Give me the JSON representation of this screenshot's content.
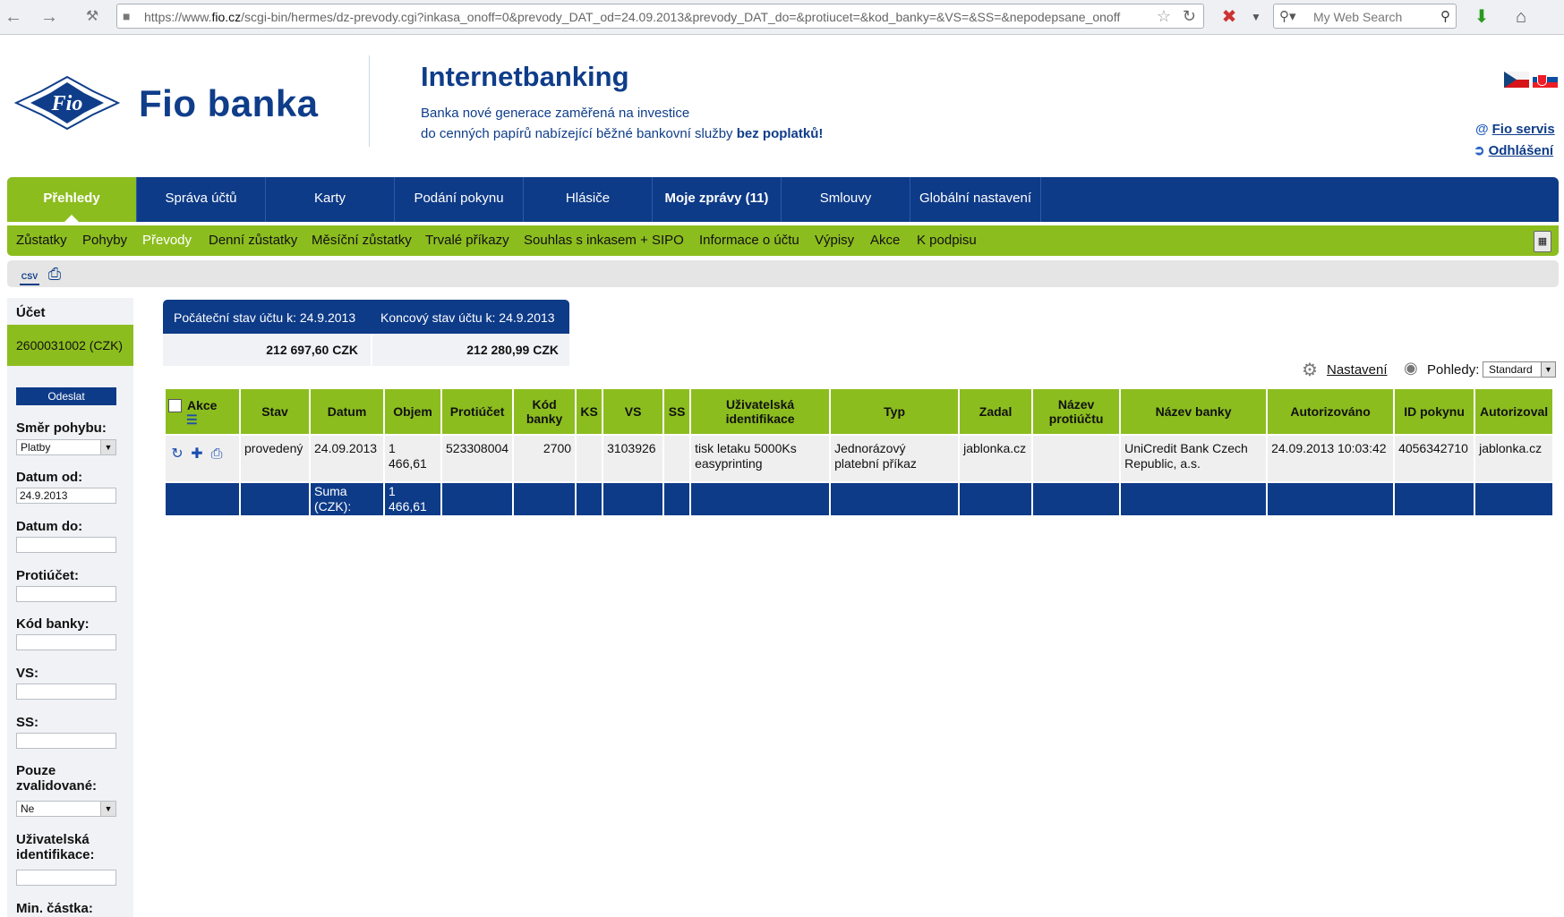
{
  "browser": {
    "url_prefix": "https://www.",
    "url_domain": "fio.cz",
    "url_rest": "/scgi-bin/hermes/dz-prevody.cgi?inkasa_onoff=0&prevody_DAT_od=24.09.2013&prevody_DAT_do=&protiucet=&kod_banky=&VS=&SS=&nepodepsane_onoff",
    "search_placeholder": "My Web Search"
  },
  "header": {
    "brand": "Fio banka",
    "logo_text": "Fio",
    "title": "Internetbanking",
    "tagline_1": "Banka nové generace zaměřená na investice",
    "tagline_2": "do cenných papírů nabízející běžné bankovní služby ",
    "tagline_2_bold": "bez poplatků!",
    "link_servis": "Fio servis",
    "link_logout": "Odhlášení"
  },
  "main_nav": [
    {
      "label": "Přehledy",
      "active": true
    },
    {
      "label": "Správa účtů"
    },
    {
      "label": "Karty"
    },
    {
      "label": "Podání pokynu"
    },
    {
      "label": "Hlásiče"
    },
    {
      "label": "Moje zprávy (11)",
      "bold": true
    },
    {
      "label": "Smlouvy"
    },
    {
      "label": "Globální nastavení"
    }
  ],
  "sub_nav": [
    {
      "label": "Zůstatky"
    },
    {
      "label": "Pohyby"
    },
    {
      "label": "Převody",
      "active": true
    },
    {
      "label": "Denní zůstatky"
    },
    {
      "label": "Měsíční zůstatky"
    },
    {
      "label": "Trvalé příkazy"
    },
    {
      "label": "Souhlas s inkasem + SIPO"
    },
    {
      "label": "Informace o účtu"
    },
    {
      "label": "Výpisy"
    },
    {
      "label": "Akce"
    },
    {
      "label": "K podpisu"
    }
  ],
  "toolbar": {
    "csv_label": "CSV"
  },
  "sidebar": {
    "account_label": "Účet",
    "account_value": "2600031002 (CZK)",
    "submit_label": "Odeslat",
    "direction_label": "Směr pohybu:",
    "direction_value": "Platby",
    "date_from_label": "Datum od:",
    "date_from_value": "24.9.2013",
    "date_to_label": "Datum do:",
    "counter_account_label": "Protiúčet:",
    "bank_code_label": "Kód banky:",
    "vs_label": "VS:",
    "ss_label": "SS:",
    "validated_label_1": "Pouze",
    "validated_label_2": "zvalidované:",
    "validated_value": "Ne",
    "user_id_label_1": "Uživatelská",
    "user_id_label_2": "identifikace:",
    "min_amount_label": "Min. částka:"
  },
  "balance": {
    "start_label": "Počáteční stav účtu k: 24.9.2013",
    "end_label": "Koncový stav účtu k: 24.9.2013",
    "start_value": "212 697,60 CZK",
    "end_value": "212 280,99 CZK"
  },
  "settings": {
    "settings_link": "Nastavení",
    "views_label": "Pohledy:",
    "views_value": "Standard"
  },
  "table": {
    "headers": {
      "akce": "Akce",
      "stav": "Stav",
      "datum": "Datum",
      "objem": "Objem",
      "protiucet": "Protiúčet",
      "kod_banky_1": "Kód",
      "kod_banky_2": "banky",
      "ks": "KS",
      "vs": "VS",
      "ss": "SS",
      "uziv_1": "Uživatelská",
      "uziv_2": "identifikace",
      "typ": "Typ",
      "zadal": "Zadal",
      "nazev_protiuctu_1": "Název",
      "nazev_protiuctu_2": "protiúčtu",
      "nazev_banky": "Název banky",
      "autorizovano": "Autorizováno",
      "id_pokynu": "ID pokynu",
      "autorizoval": "Autorizoval"
    },
    "row": {
      "stav": "provedený",
      "datum": "24.09.2013",
      "objem": "1 466,61",
      "protiucet": "523308004",
      "kod_banky": "2700",
      "ks": "",
      "vs": "3103926",
      "ss": "",
      "uziv_1": "tisk letaku 5000Ks",
      "uziv_2": "easyprinting",
      "typ_1": "Jednorázový",
      "typ_2": "platební příkaz",
      "zadal": "jablonka.cz",
      "nazev_protiuctu": "",
      "nazev_banky_1": "UniCredit Bank Czech",
      "nazev_banky_2": "Republic, a.s.",
      "autorizovano": "24.09.2013 10:03:42",
      "id_pokynu": "4056342710",
      "autorizoval": "jablonka.cz"
    },
    "sum_label": "Suma (CZK):",
    "sum_value": "1 466,61"
  }
}
